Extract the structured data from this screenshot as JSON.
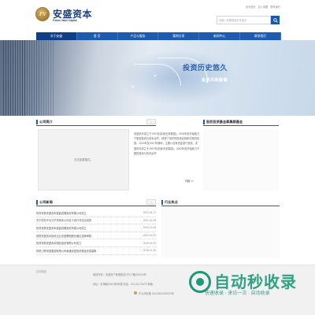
{
  "header": {
    "top_links": [
      "设为首页",
      "加入收藏",
      "联系我们"
    ],
    "logo": {
      "emblem": "FV",
      "name": "安盛资本",
      "en": "Future Value Capital"
    },
    "search": {
      "placeholder": "请输入您要搜索的关键词"
    }
  },
  "nav": {
    "items": [
      "关于安盛",
      "首 页",
      "产品与服务",
      "案例分享",
      "新闻中心",
      "联系我们"
    ],
    "active": "关于安盛"
  },
  "banner": {
    "title": "投资历史悠久",
    "subtitle": "投资风格稳健"
  },
  "intro": {
    "title": "公司简介",
    "more": "+",
    "image_alt": "无法加载插件。",
    "text": "安盛资本成立于1997年(前身天安集团)，2000年前开始致力于股权投资与资本运作，获得了良好的投资经验和可观的回报。2000年至2007年期间，主要以自有资金进行投资。安盛资本成立于1997年(前身天安集团)，2000年前开始致力于股权投资与资本运作",
    "detail": "详细 >>"
  },
  "fund": {
    "title": "股权投资基金募集期基金"
  },
  "news": {
    "title": "公司新闻",
    "more": "+",
    "items": [
      {
        "title": "热烈祝贺安盛资本盛鑫四期投资有限公司成立",
        "date": "2022-04-17"
      },
      {
        "title": "关于防范不法分子冒用本公司名义进行非法活动的",
        "date": "2021-01-06"
      },
      {
        "title": "热烈祝贺安盛资本盛鑫四期投资有限公司成立",
        "date": "2020-12-08"
      },
      {
        "title": "祝贺安盛资本投资企业安盛腾翔股份通过挂牌审核",
        "date": "2020-02-02"
      },
      {
        "title": "热烈祝贺安盛资本国信投资有限公司成立",
        "date": "2019-02-02"
      },
      {
        "title": "祝贺江联安盛集团有限公司南通安盛投资基金完成募集",
        "date": "2018-07-25"
      }
    ]
  },
  "hot": {
    "title": "行业热点"
  },
  "footer": {
    "left_link": "友情链接",
    "line1": "版权所有：安盛资产管理集团    沪ICP备000000号",
    "line2": "地址：虹梅路3081号5栋楼    电话：021-62175479    邮箱：",
    "line3": "沪公网安备 31010502000000号"
  },
  "watermark": {
    "title": "自动秒收录",
    "sub": "快速收录 · 来访一次 · 自动收录"
  }
}
